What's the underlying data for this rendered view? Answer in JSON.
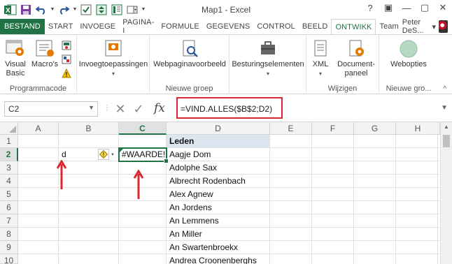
{
  "window": {
    "title": "Map1 - Excel",
    "controls": [
      "?",
      "▣",
      "—",
      "▢",
      "✕"
    ]
  },
  "qat": {
    "icons": [
      "excel-logo-icon",
      "save-icon",
      "undo-icon",
      "redo-icon",
      "checkbox-form-icon",
      "spin-button-icon",
      "form-icon",
      "combo-box-icon",
      "customize-icon"
    ]
  },
  "tabs": [
    {
      "label": "BESTAND",
      "kind": "file"
    },
    {
      "label": "START"
    },
    {
      "label": "INVOEGE"
    },
    {
      "label": "PAGINA-I"
    },
    {
      "label": "FORMULE"
    },
    {
      "label": "GEGEVENS"
    },
    {
      "label": "CONTROL"
    },
    {
      "label": "BEELD"
    },
    {
      "label": "ONTWIKK",
      "active": true
    },
    {
      "label": "Team"
    }
  ],
  "user": {
    "name": "Peter DeS...",
    "dropdown": "▾"
  },
  "ribbon": {
    "groups": [
      {
        "label": "Programmacode",
        "buttons": [
          "Visual Basic",
          "Macro's"
        ]
      },
      {
        "label": "",
        "buttons": [
          "Invoegtoepassingen"
        ]
      },
      {
        "label": "Nieuwe groep",
        "buttons": [
          "Webpaginavoorbeeld"
        ]
      },
      {
        "label": "",
        "buttons": [
          "Besturingselementen"
        ]
      },
      {
        "label": "Wijzigen",
        "buttons": [
          "XML",
          "Document-paneel"
        ]
      },
      {
        "label": "Nieuwe gro...",
        "buttons": [
          "Webopties"
        ]
      }
    ],
    "visual_basic": "Visual",
    "visual_basic2": "Basic",
    "macros": "Macro's",
    "invoeg": "Invoegtoepassingen",
    "webpagina": "Webpaginavoorbeeld",
    "besturing": "Besturingselementen",
    "xml": "XML",
    "document1": "Document-",
    "document2": "paneel",
    "webopties": "Webopties",
    "grp_programmacode": "Programmacode",
    "grp_nieuwe": "Nieuwe groep",
    "grp_wijzigen": "Wijzigen",
    "grp_nieuwe2": "Nieuwe gro...",
    "collapse": "^"
  },
  "formula_bar": {
    "name_box": "C2",
    "cancel": "✕",
    "enter": "✓",
    "fx": "fx",
    "formula": "=VIND.ALLES($B$2;D2)"
  },
  "grid": {
    "columns": [
      "A",
      "B",
      "C",
      "D",
      "E",
      "F",
      "G",
      "H"
    ],
    "selected_column": "C",
    "rows": [
      "1",
      "2",
      "3",
      "4",
      "5",
      "6",
      "7",
      "8",
      "9",
      "10"
    ],
    "selected_row": "2",
    "cells": {
      "B2": "d",
      "C2": "#WAARDE!",
      "D1": "Leden"
    },
    "leden": [
      "Aagje Dom",
      "Adolphe Sax",
      "Albrecht Rodenbach",
      "Alex Agnew",
      "An Jordens",
      "An Lemmens",
      "An Miller",
      "An Swartenbroekx",
      "Andrea Croonenberghs"
    ],
    "error_indicator": "!",
    "annotation_arrow_color": "#d9282f"
  }
}
